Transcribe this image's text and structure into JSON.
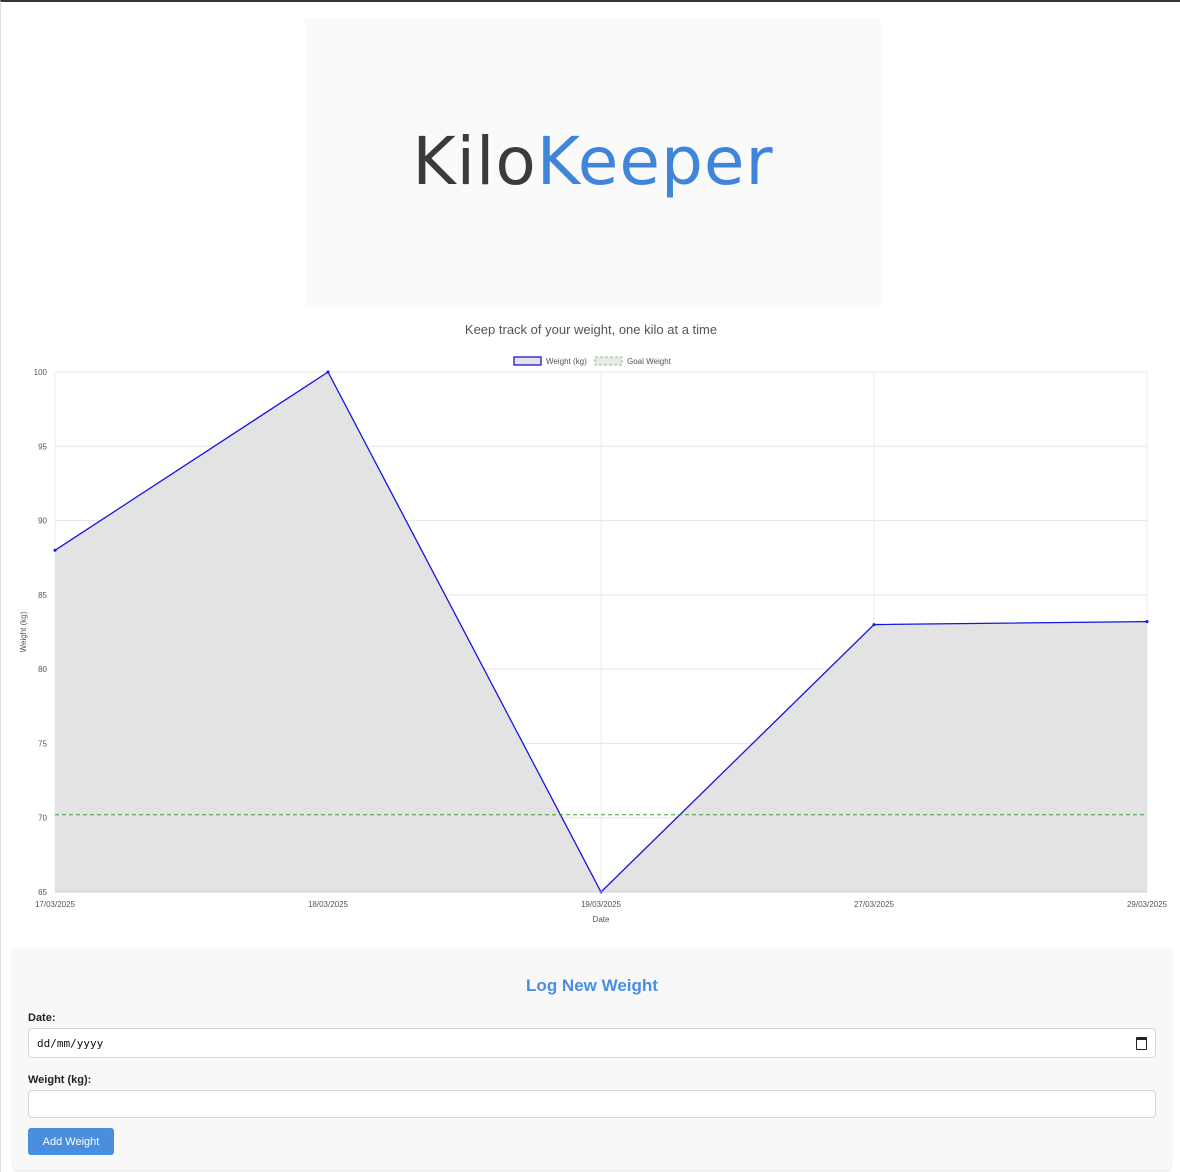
{
  "brand": {
    "part1": "Kilo",
    "part2": "Keeper",
    "tagline": "Keep track of your weight, one kilo at a time"
  },
  "colors": {
    "brand_dark": "#3f3a3a",
    "brand_blue": "#3f86da",
    "weight_line": "#1515e0",
    "weight_fill": "#e3e3e3",
    "goal_line": "#3f9a3f",
    "button": "#4a8fde"
  },
  "chart_data": {
    "type": "area",
    "categories": [
      "17/03/2025",
      "18/03/2025",
      "19/03/2025",
      "27/03/2025",
      "29/03/2025"
    ],
    "series": [
      {
        "name": "Weight (kg)",
        "values": [
          88,
          100,
          65,
          83,
          83.2
        ]
      },
      {
        "name": "Goal Weight",
        "values": [
          70.2,
          70.2,
          70.2,
          70.2,
          70.2
        ]
      }
    ],
    "xlabel": "Date",
    "ylabel": "Weight (kg)",
    "ylim": [
      65,
      100
    ],
    "yticks": [
      "100",
      "95",
      "90",
      "85",
      "80",
      "75",
      "70",
      "65"
    ],
    "legend": "top-center",
    "grid": true
  },
  "form": {
    "title": "Log New Weight",
    "date_label": "Date:",
    "date_placeholder": "dd/mm/yyyy",
    "weight_label": "Weight (kg):",
    "weight_value": "",
    "add_button": "Add Weight"
  }
}
